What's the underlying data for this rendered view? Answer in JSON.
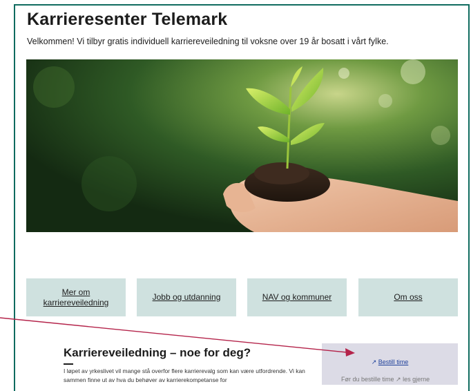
{
  "header": {
    "title": "Karrieresenter Telemark",
    "intro": "Velkommen! Vi tilbyr gratis individuell karriereveiledning til voksne over 19 år bosatt i vårt fylke."
  },
  "nav_boxes": [
    {
      "label": "Mer om karriereveiledning"
    },
    {
      "label": "Jobb og utdanning"
    },
    {
      "label": "NAV og kommuner"
    },
    {
      "label": "Om oss"
    }
  ],
  "section": {
    "title": "Karriereveiledning – noe for deg?",
    "text": "I løpet av yrkeslivet vil mange stå overfor flere karrierevalg som kan være utfordrende. Vi kan sammen finne ut av hva du behøver av karrierekompetanse for"
  },
  "sidebar": {
    "book_label": "Bestill time",
    "note": "Før du bestille time ↗ les gjerne"
  },
  "colors": {
    "accent": "#0f6b5f",
    "nav_box_bg": "#cfe1df",
    "side_box_bg": "#dcdbe6",
    "link": "#1d3f9a",
    "annotation_arrow": "#b4234a"
  },
  "icons": {
    "book_icon": "external-link-icon"
  }
}
